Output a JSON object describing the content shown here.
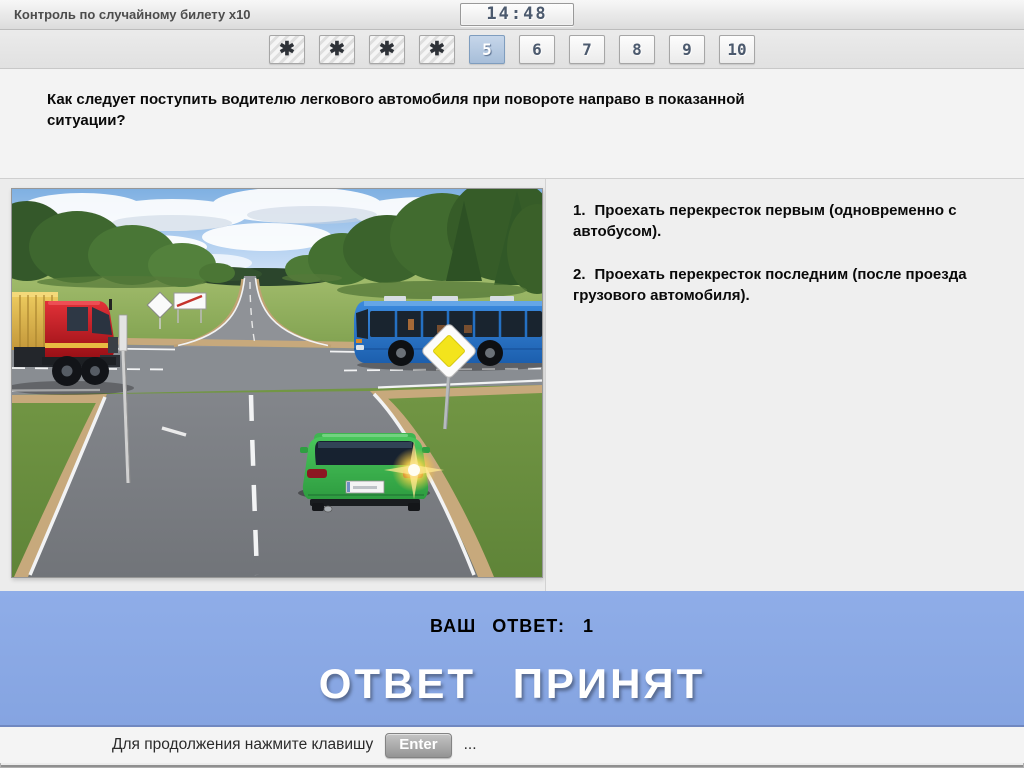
{
  "header": {
    "title": "Контроль по случайному билету x10",
    "timer": "14:48"
  },
  "tabs": [
    {
      "label": "✱",
      "state": "answered"
    },
    {
      "label": "✱",
      "state": "answered"
    },
    {
      "label": "✱",
      "state": "answered"
    },
    {
      "label": "✱",
      "state": "answered"
    },
    {
      "label": "5",
      "state": "active"
    },
    {
      "label": "6",
      "state": "default"
    },
    {
      "label": "7",
      "state": "default"
    },
    {
      "label": "8",
      "state": "default"
    },
    {
      "label": "9",
      "state": "default"
    },
    {
      "label": "10",
      "state": "default"
    }
  ],
  "question": {
    "text": "Как следует поступить водителю легкового автомобиля при повороте направо в показанной ситуации?"
  },
  "answers": [
    {
      "number": "1.",
      "text": "Проехать перекресток первым (одновременно с автобусом)."
    },
    {
      "number": "2.",
      "text": "Проехать перекресток последним (после проезда грузового автомобиля)."
    }
  ],
  "result": {
    "answer_label": "ВАШ ОТВЕТ:",
    "answer_value": "1",
    "status": "ОТВЕТ ПРИНЯТ"
  },
  "footer": {
    "prompt": "Для продолжения нажмите клавишу",
    "key_label": "Enter",
    "suffix": "..."
  },
  "scene": {
    "objects": [
      "sky",
      "clouds",
      "forest",
      "grass",
      "main-road",
      "cross-road",
      "red-dump-truck",
      "blue-bus",
      "green-car",
      "right-turn-signal-glow",
      "priority-road-sign",
      "distant-road-signs",
      "sign-pole"
    ]
  },
  "colors": {
    "result_panel_blue": "#8AA9E5",
    "active_tab_blue": "#B3C9E2",
    "digit_slate": "#4C5A6E",
    "asphalt": "#85888D",
    "grass_green": "#7FA04F",
    "sign_yellow": "#F3E41C",
    "truck_red": "#C41E24",
    "truck_bed_yellow": "#E4BC4E",
    "bus_blue": "#2678CC",
    "car_green": "#3DB54E"
  }
}
